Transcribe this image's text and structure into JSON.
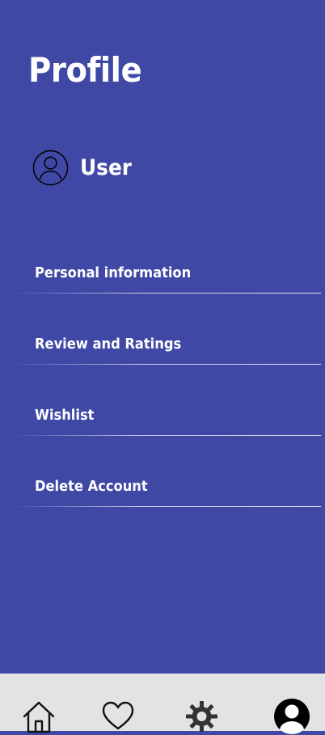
{
  "header": {
    "title": "Profile"
  },
  "user": {
    "name": "User",
    "avatar_icon": "user-circle-icon"
  },
  "menu": {
    "items": [
      {
        "label": "Personal information"
      },
      {
        "label": "Review and Ratings"
      },
      {
        "label": "Wishlist"
      },
      {
        "label": "Delete Account"
      }
    ]
  },
  "bottom_nav": {
    "items": [
      {
        "icon": "home-icon",
        "active": false
      },
      {
        "icon": "heart-icon",
        "active": false
      },
      {
        "icon": "gear-icon",
        "active": false
      },
      {
        "icon": "profile-icon",
        "active": true
      }
    ]
  },
  "colors": {
    "background": "#4048a6",
    "nav_background": "#e3e3e3",
    "text": "#ffffff",
    "icon": "#111111"
  }
}
